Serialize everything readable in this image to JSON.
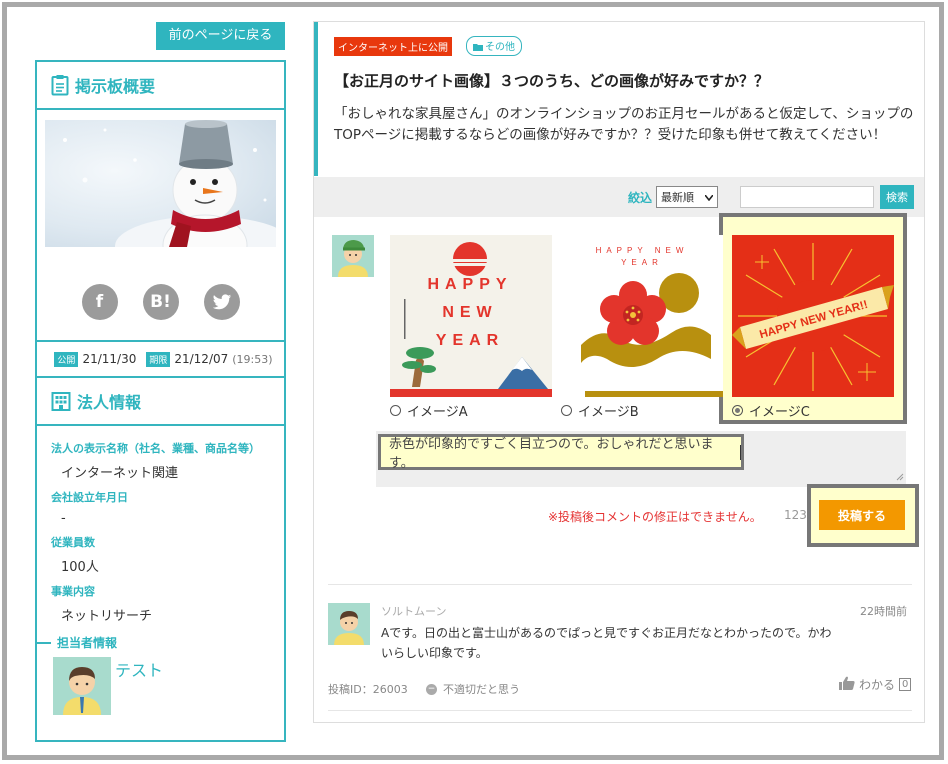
{
  "sidebar": {
    "back_label": "前のページに戻る",
    "overview_title": "掲示板概要",
    "share": {
      "facebook": "f",
      "hatena": "B!",
      "twitter": "twitter"
    },
    "dates": {
      "publish_tag": "公開",
      "publish_date": "21/11/30",
      "deadline_tag": "期限",
      "deadline_date": "21/12/07",
      "deadline_time": "(19:53)"
    },
    "corp_title": "法人情報",
    "corp_fields": [
      {
        "label": "法人の表示名称（社名、業種、商品名等）",
        "value": "インターネット関連"
      },
      {
        "label": "会社設立年月日",
        "value": "-"
      },
      {
        "label": "従業員数",
        "value": "100人"
      },
      {
        "label": "事業内容",
        "value": "ネットリサーチ"
      }
    ],
    "contact_title": "担当者情報",
    "contact_name": "テスト"
  },
  "question": {
    "badge_public": "インターネット上に公開",
    "badge_category": "その他",
    "title": "【お正月のサイト画像】３つのうち、どの画像が好みですか？？",
    "description": "「おしゃれな家具屋さん」のオンラインショップのお正月セールがあると仮定して、ショップのTOPページに掲載するならどの画像が好みですか？？受けた印象も併せて教えてください！"
  },
  "filter": {
    "label": "絞込",
    "sort_value": "最新順",
    "search_button": "検索"
  },
  "options": [
    {
      "label": "イメージA",
      "selected": false,
      "art_text": [
        "HAPPY",
        "NEW",
        "YEAR"
      ]
    },
    {
      "label": "イメージB",
      "selected": false,
      "art_text": [
        "HAPPY NEW",
        "YEAR"
      ]
    },
    {
      "label": "イメージC",
      "selected": true,
      "art_text": [
        "HAPPY NEW YEAR!!"
      ]
    }
  ],
  "compose": {
    "text": "赤色が印象的ですごく目立つので。おしゃれだと思います。",
    "warning": "※投稿後コメントの修正はできません。",
    "count": "123",
    "post_button": "投稿する"
  },
  "comment": {
    "author": "ソルトムーン",
    "time": "22時間前",
    "text": "Aです。日の出と富士山があるのでぱっと見ですぐお正月だなとわかったので。かわいらしい印象です。",
    "post_id": "投稿ID：26003",
    "report_label": "不適切だと思う",
    "like_label": "わかる",
    "like_count": "0"
  },
  "colors": {
    "accent": "#2fb5bf",
    "orange": "#f39800",
    "red": "#e8380d",
    "highlight": "#ffffcc"
  }
}
